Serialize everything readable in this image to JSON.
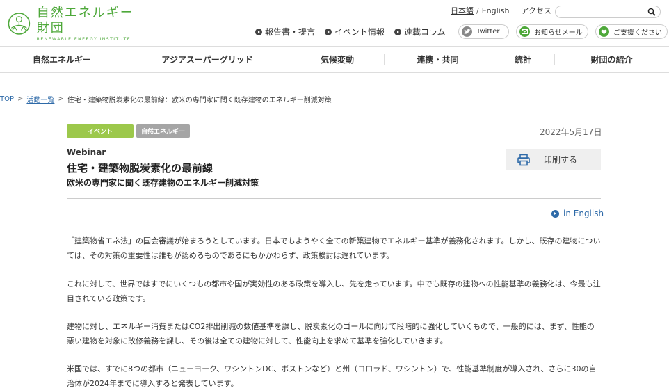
{
  "header": {
    "logo_jp": "自然エネルギー財団",
    "logo_en": "RENEWABLE ENERGY INSTITUTE",
    "lang_jp": "日本語",
    "lang_sep": "/",
    "lang_en": "English",
    "access": "アクセス",
    "search_placeholder": "",
    "sub_nav": [
      "報告書・提言",
      "イベント情報",
      "連載コラム"
    ],
    "twitter": "Twitter",
    "mail": "お知らせメール",
    "support": "ご支援ください"
  },
  "main_nav": [
    "自然エネルギー",
    "アジアスーパーグリッド",
    "気候変動",
    "連携・共同",
    "統計",
    "財団の紹介"
  ],
  "breadcrumb": {
    "top": "TOP",
    "activity": "活動一覧",
    "current": "住宅・建築物脱炭素化の最前線：欧米の専門家に聞く既存建物のエネルギー削減対策"
  },
  "article": {
    "tag_event": "イベント",
    "tag_category": "自然エネルギー",
    "date": "2022年5月17日",
    "kicker": "Webinar",
    "title": "住宅・建築物脱炭素化の最前線",
    "subtitle": "欧米の専門家に聞く既存建物のエネルギー削減対策",
    "print_label": "印刷する",
    "in_english": "in English",
    "paragraphs": [
      "「建築物省エネ法」の国会審議が始まろうとしています。日本でもようやく全ての新築建物でエネルギー基準が義務化されます。しかし、既存の建物については、その対策の重要性は誰もが認めるものであるにもかかわらず、政策検討は遅れています。",
      "これに対して、世界ではすでにいくつもの都市や国が実効性のある政策を導入し、先を走っています。中でも既存の建物への性能基準の義務化は、今最も注目されている政策です。",
      "建物に対し、エネルギー消費またはCO2排出削減の数値基準を課し、脱炭素化のゴールに向けて段階的に強化していくもので、一般的には、まず、性能の悪い建物を対象に改修義務を課し、その後は全ての建物に対して、性能向上を求めて基準を強化していきます。",
      "米国では、すでに8つの都市（ニューヨーク、ワシントンDC、ボストンなど）と州（コロラド、ワシントン）で、性能基準制度が導入され、さらに30の自治体が2024年までに導入すると発表しています。"
    ]
  },
  "colors": {
    "accent_green": "#4ea83a",
    "tag_event": "#9cc84b",
    "tag_category": "#a5a5a5",
    "link": "#2e6aa8"
  }
}
